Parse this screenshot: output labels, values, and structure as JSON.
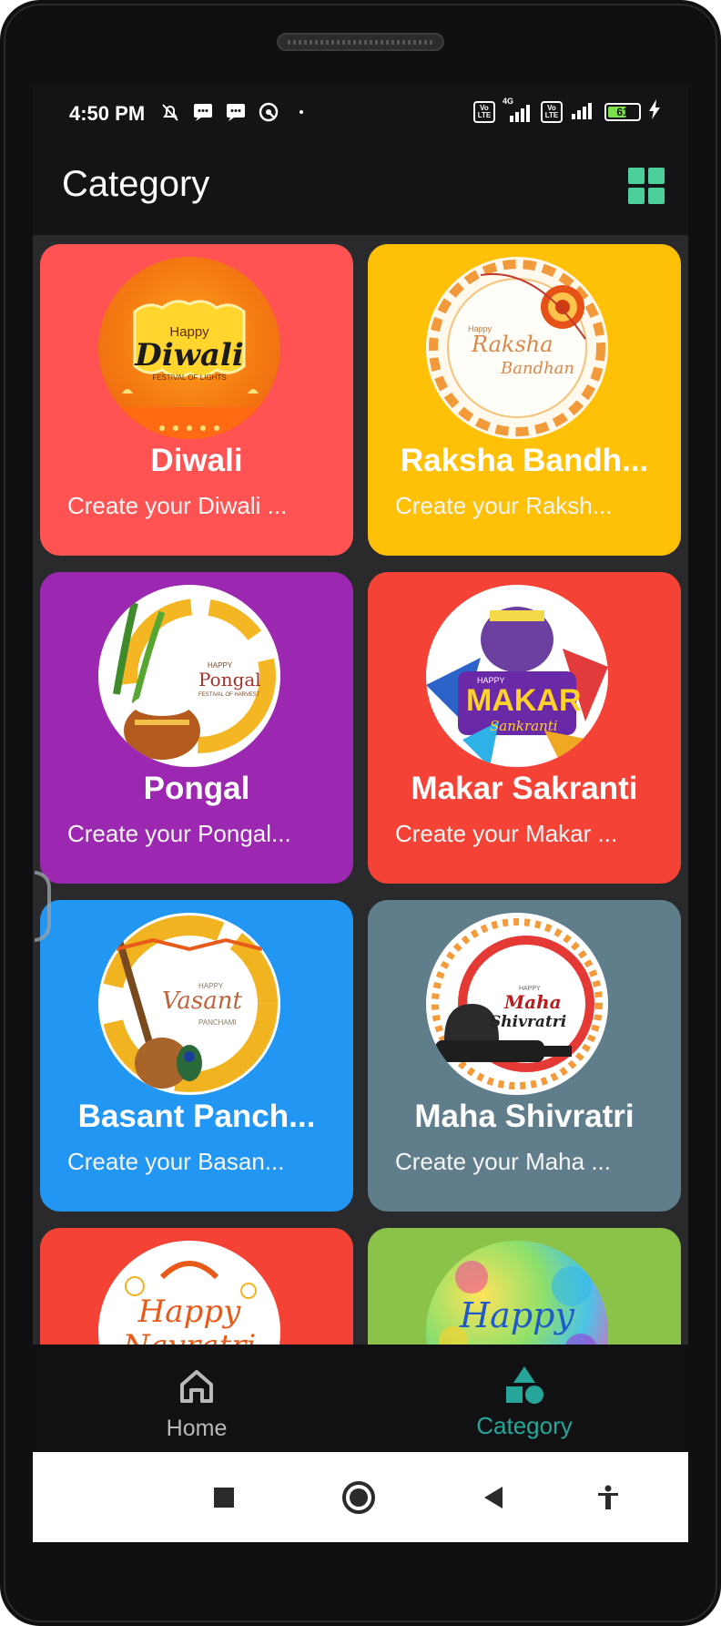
{
  "status_bar": {
    "time": "4:50 PM",
    "network_1": "4G",
    "lte_label": "Vo LTE",
    "battery": "61",
    "battery_level": 0.61
  },
  "app_bar": {
    "title": "Category",
    "view_toggle_icon": "grid-view-icon",
    "accent_color": "#4ccf9a"
  },
  "categories": [
    {
      "title": "Diwali",
      "subtitle": "Create your Diwali ...",
      "color": "#ff5252"
    },
    {
      "title": "Raksha Bandh...",
      "subtitle": "Create your Raksh...",
      "color": "#ffc107"
    },
    {
      "title": "Pongal",
      "subtitle": "Create your Pongal...",
      "color": "#9c27b0"
    },
    {
      "title": "Makar Sakranti",
      "subtitle": "Create your Makar ...",
      "color": "#f44336"
    },
    {
      "title": "Basant Panch...",
      "subtitle": "Create your Basan...",
      "color": "#2196f3"
    },
    {
      "title": "Maha Shivratri",
      "subtitle": "Create your Maha ...",
      "color": "#607d8b"
    },
    {
      "title": "",
      "subtitle": "",
      "color": "#f44336"
    },
    {
      "title": "",
      "subtitle": "",
      "color": "#8bc34a"
    }
  ],
  "card_images": {
    "diwali_text_small": "Happy",
    "diwali_text": "Diwali",
    "diwali_caption": "FESTIVAL OF LIGHTS",
    "raksha_small": "Happy",
    "raksha_text_1": "Raksha",
    "raksha_text_2": "Bandhan",
    "pongal_small": "HAPPY",
    "pongal_text": "Pongal",
    "pongal_caption": "FESTIVAL OF HARVEST",
    "makar_small": "HAPPY",
    "makar_text": "MAKAR",
    "makar_sub": "Sankranti",
    "vasant_small": "HAPPY",
    "vasant_text": "Vasant",
    "vasant_sub": "PANCHAMI",
    "shiv_small": "HAPPY",
    "shiv_text_1": "Maha",
    "shiv_text_2": "Shivratri",
    "navratri_text": "Happy",
    "navratri_text_2": "Navratri",
    "holi_text": "Happy"
  },
  "bottom_nav": {
    "items": [
      {
        "label": "Home",
        "icon": "home-icon",
        "active": false
      },
      {
        "label": "Category",
        "icon": "category-shapes-icon",
        "active": true
      }
    ],
    "active_color": "#26a69a",
    "inactive_color": "#b8b8b8"
  },
  "system_nav": {
    "buttons": [
      "recents-square-icon",
      "home-circle-icon",
      "back-triangle-icon",
      "accessibility-icon"
    ]
  }
}
